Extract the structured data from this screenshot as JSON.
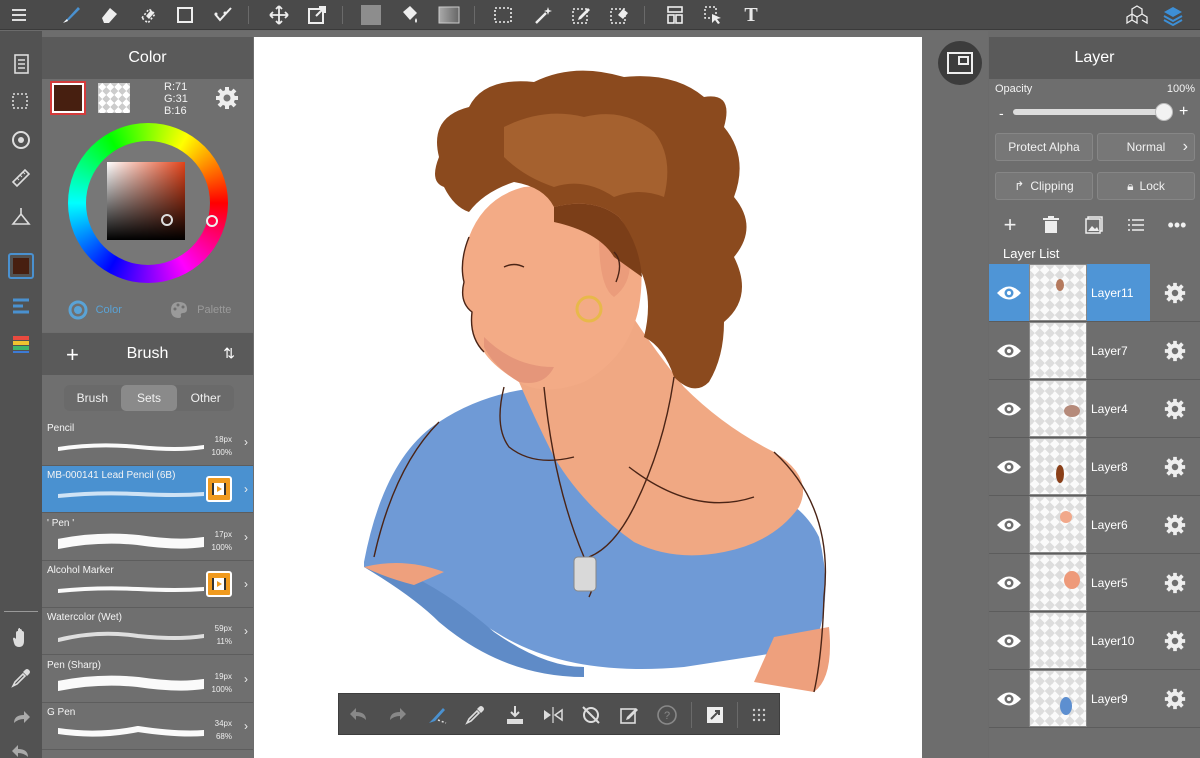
{
  "toolbar": {
    "tools": [
      "menu-icon",
      "brush-icon",
      "eraser-icon",
      "lasso-eraser-icon",
      "rectangle-icon",
      "select-pen-icon",
      "move-icon",
      "transform-icon",
      "fill-swatch-icon",
      "bucket-icon",
      "gradient-icon",
      "marquee-icon",
      "magic-wand-icon",
      "select-pen2-icon",
      "select-eraser-icon",
      "panels-icon",
      "pointer-icon",
      "text-icon",
      "materials-icon",
      "layers-icon"
    ],
    "text_tool_label": "T"
  },
  "rail": {
    "tools": [
      "pages-icon",
      "selection-icon",
      "rotate-icon",
      "ruler-icon",
      "perspective-icon",
      "color-swatch-icon",
      "brush-list-icon",
      "color-bars-icon",
      "hand-icon",
      "eyedropper-icon",
      "redo-icon",
      "undo-icon"
    ]
  },
  "color_panel": {
    "title": "Color",
    "main_color": "#471f10",
    "r": "R:71",
    "g": "G:31",
    "b": "B:16",
    "tab_color": "Color",
    "tab_palette": "Palette"
  },
  "brush_panel": {
    "title": "Brush",
    "add_label": "+",
    "tabs": [
      "Brush",
      "Sets",
      "Other"
    ],
    "selected_tab": "Sets",
    "items": [
      {
        "name": "Pencil",
        "size": "18px",
        "opacity": "100%",
        "selected": false,
        "movie": false
      },
      {
        "name": "MB-000141 Lead Pencil (6B)",
        "size": "",
        "opacity": "",
        "selected": true,
        "movie": true
      },
      {
        "name": "' Pen '",
        "size": "17px",
        "opacity": "100%",
        "selected": false,
        "movie": false
      },
      {
        "name": "Alcohol Marker",
        "size": "",
        "opacity": "",
        "selected": false,
        "movie": true
      },
      {
        "name": "Watercolor (Wet)",
        "size": "59px",
        "opacity": "11%",
        "selected": false,
        "movie": false
      },
      {
        "name": "Pen (Sharp)",
        "size": "19px",
        "opacity": "100%",
        "selected": false,
        "movie": false
      },
      {
        "name": "G Pen",
        "size": "34px",
        "opacity": "68%",
        "selected": false,
        "movie": false
      }
    ]
  },
  "bottom_bar": {
    "tools": [
      "undo-icon",
      "redo-icon",
      "fill-brush-icon",
      "eyedropper-icon",
      "save-icon",
      "flip-icon",
      "rotate-reset-icon",
      "edit-icon",
      "help-icon",
      "snap-icon",
      "grid-icon"
    ]
  },
  "layer_panel": {
    "title": "Layer",
    "opacity_label": "Opacity",
    "opacity_value": "100%",
    "opacity_fraction": 1.0,
    "minus": "-",
    "plus": "+",
    "protect_alpha": "Protect Alpha",
    "blend_mode": "Normal",
    "clipping": "Clipping",
    "lock": "Lock",
    "list_label": "Layer List",
    "layers": [
      {
        "name": "Layer11",
        "selected": true,
        "thumb": "#b57a5e"
      },
      {
        "name": "Layer7",
        "selected": false,
        "thumb": ""
      },
      {
        "name": "Layer4",
        "selected": false,
        "thumb": "#b58a7a"
      },
      {
        "name": "Layer8",
        "selected": false,
        "thumb": "#8a3f18"
      },
      {
        "name": "Layer6",
        "selected": false,
        "thumb": "#f1a88a"
      },
      {
        "name": "Layer5",
        "selected": false,
        "thumb": "#ee9a7a"
      },
      {
        "name": "Layer10",
        "selected": false,
        "thumb": ""
      },
      {
        "name": "Layer9",
        "selected": false,
        "thumb": "#5d8fd0"
      }
    ]
  },
  "colors": {
    "accent": "#4a91d0",
    "hair": "#8b4a1e",
    "skin": "#eea07d",
    "shirt": "#6f9ad6",
    "line": "#4a2416"
  }
}
